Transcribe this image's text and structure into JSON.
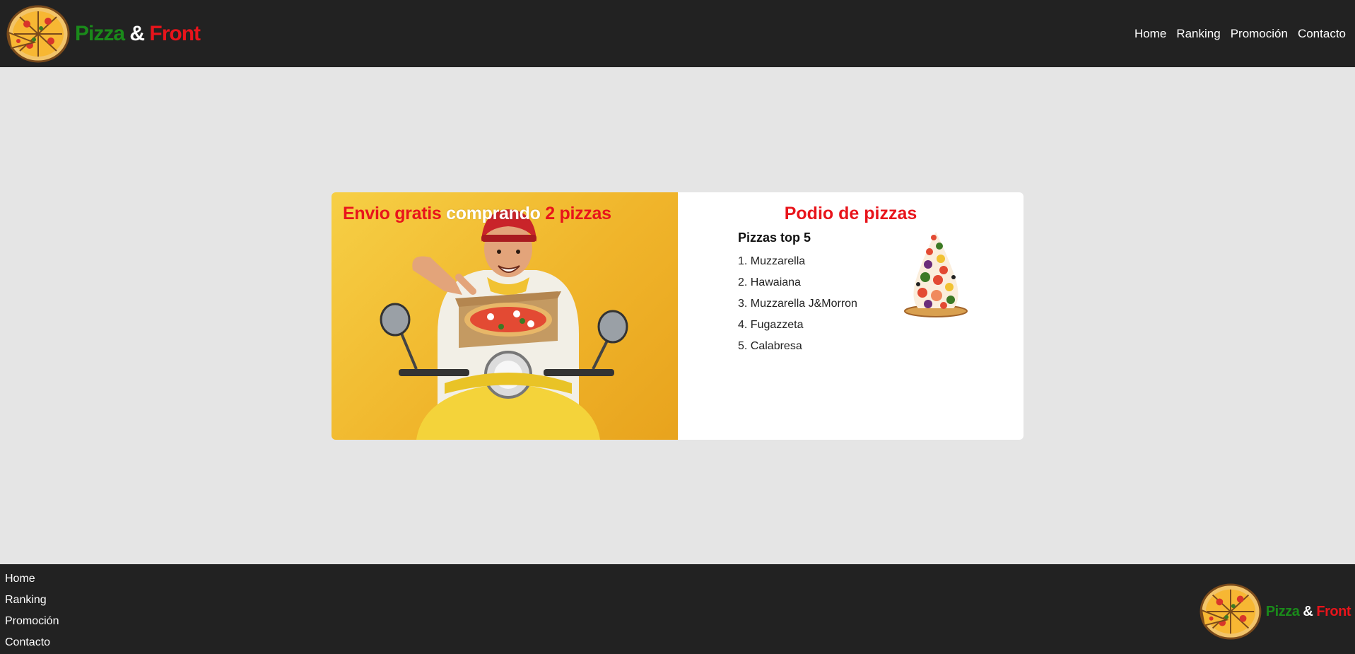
{
  "header": {
    "brand": {
      "word1": "Pizza",
      "amp": "&",
      "word2": "Front"
    },
    "nav": [
      "Home",
      "Ranking",
      "Promoción",
      "Contacto"
    ]
  },
  "promo": {
    "title_part1": "Envio gratis",
    "title_part2": "comprando",
    "title_part3": "2 pizzas"
  },
  "podium": {
    "title": "Podio de pizzas",
    "subtitle": "Pizzas top 5",
    "items": [
      "1. Muzzarella",
      "2. Hawaiana",
      "3. Muzzarella J&Morron",
      "4. Fugazzeta",
      "5. Calabresa"
    ]
  },
  "footer": {
    "nav": [
      "Home",
      "Ranking",
      "Promoción",
      "Contacto"
    ],
    "brand": {
      "word1": "Pizza",
      "amp": "&",
      "word2": "Front"
    }
  },
  "colors": {
    "header_bg": "#222222",
    "page_bg": "#e5e5e5",
    "brand_green": "#1a8a1a",
    "brand_red": "#e8141b",
    "promo_yellow": "#f0b52b"
  }
}
